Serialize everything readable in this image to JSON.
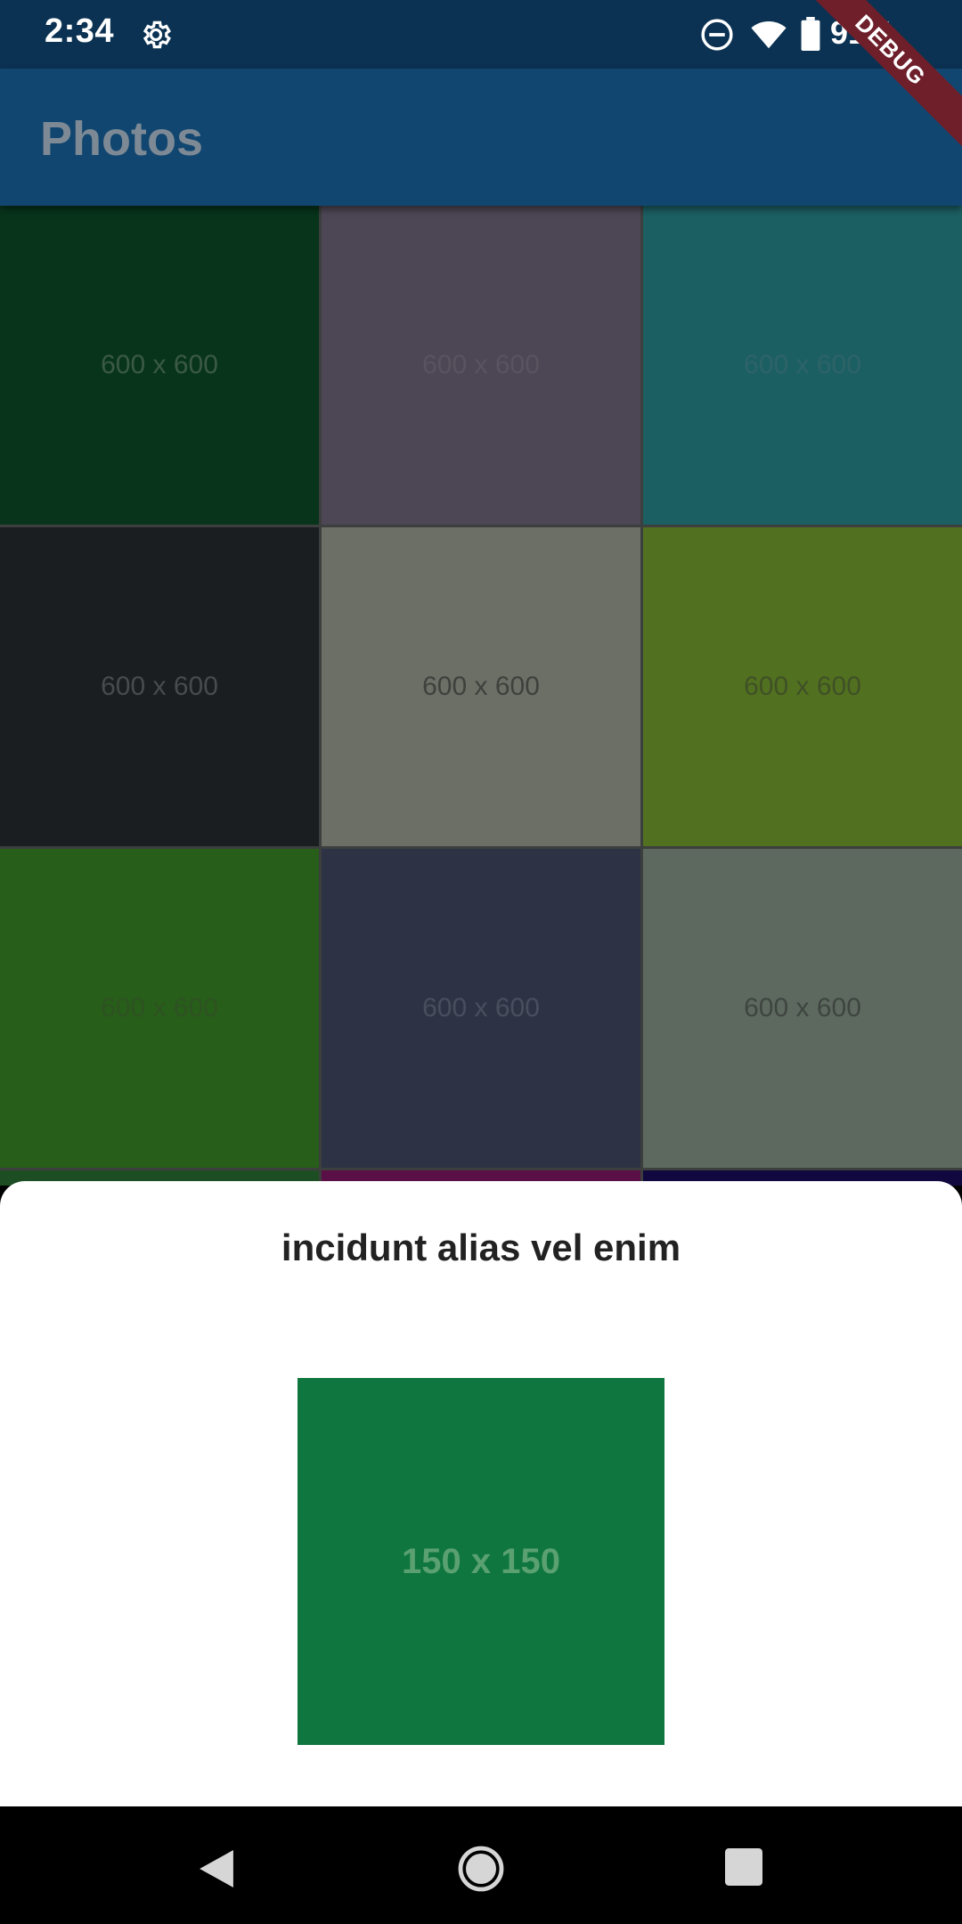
{
  "status_bar": {
    "time": "2:34",
    "battery_percent": "91%",
    "icons": [
      "settings-icon",
      "do-not-disturb-icon",
      "wifi-icon",
      "battery-icon"
    ]
  },
  "debug_banner": {
    "label": "DEBUG"
  },
  "app_bar": {
    "title": "Photos"
  },
  "grid": {
    "tiles": [
      {
        "label": "600 x 600",
        "bg": "#07341b",
        "fg": "#3e5c48"
      },
      {
        "label": "600 x 600",
        "bg": "#4d4654",
        "fg": "#5a5460"
      },
      {
        "label": "600 x 600",
        "bg": "#1c5f63",
        "fg": "#2e6468"
      },
      {
        "label": "600 x 600",
        "bg": "#1b1e21",
        "fg": "#4a4e51"
      },
      {
        "label": "600 x 600",
        "bg": "#6b6f66",
        "fg": "#3d3f3b"
      },
      {
        "label": "600 x 600",
        "bg": "#527120",
        "fg": "#3e4f27"
      },
      {
        "label": "600 x 600",
        "bg": "#275e1a",
        "fg": "#2f5222"
      },
      {
        "label": "600 x 600",
        "bg": "#2d3345",
        "fg": "#4b5060"
      },
      {
        "label": "600 x 600",
        "bg": "#5d695f",
        "fg": "#3d443f"
      },
      {
        "label": "",
        "bg": "#1d4d22",
        "fg": "#1d4d22"
      },
      {
        "label": "",
        "bg": "#5a0f46",
        "fg": "#5a0f46"
      },
      {
        "label": "",
        "bg": "#10083e",
        "fg": "#10083e"
      }
    ]
  },
  "bottom_sheet": {
    "title": "incidunt alias vel enim",
    "image_label": "150 x 150",
    "image_color": "#0f763f"
  },
  "nav_bar": {
    "icons": [
      "back-icon",
      "home-icon",
      "recents-icon"
    ]
  }
}
